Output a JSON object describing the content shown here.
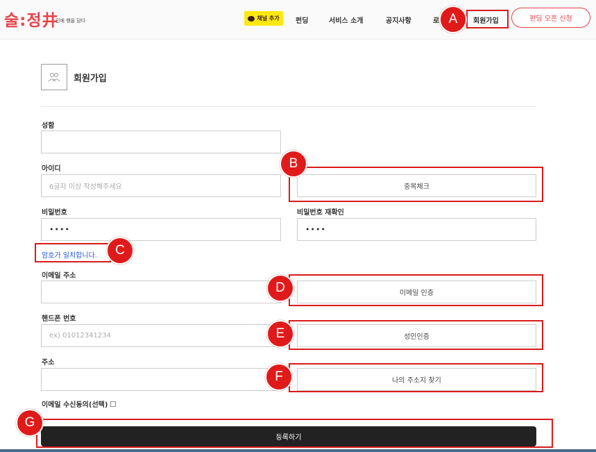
{
  "header": {
    "logo": "술:정井",
    "logo_sub": "인에 행을 담다",
    "kakao_label": "채널 추가",
    "nav": [
      "펀딩",
      "서비스 소개",
      "공지사항",
      "로",
      "회원가입"
    ],
    "fund_button": "펀딩 오픈 신청"
  },
  "page": {
    "title": "회원가입"
  },
  "form": {
    "name_label": "성함",
    "id_label": "아이디",
    "id_placeholder": "6글자 이상 작성해주세요",
    "dup_check": "중복체크",
    "password_label": "비밀번호",
    "password_value": "••••",
    "password_confirm_label": "비밀번호 재확인",
    "password_confirm_value": "••••",
    "password_match": "암호가 일치합니다.",
    "email_label": "이메일 주소",
    "email_verify": "이메일 인증",
    "phone_label": "핸드폰 번호",
    "phone_placeholder": "ex) 01012341234",
    "adult_verify": "성인인증",
    "address_label": "주소",
    "address_find": "나의 주소지 찾기",
    "email_consent": "이메일 수신동의(선택)",
    "submit": "등록하기"
  },
  "annotations": [
    "A",
    "B",
    "C",
    "D",
    "E",
    "F",
    "G"
  ],
  "colors": {
    "accent": "#e8424a",
    "annotation": "#d91a1a",
    "kakao": "#ffe812",
    "submit_bg": "#222222",
    "match_text": "#2255dd"
  }
}
